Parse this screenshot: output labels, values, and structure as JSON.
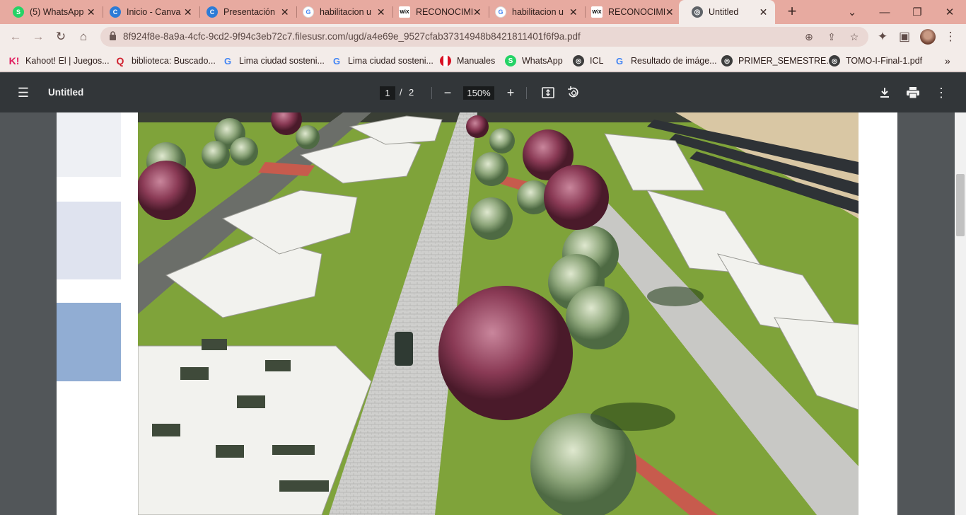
{
  "browser": {
    "tabs": [
      {
        "title": "(5) WhatsApp",
        "icon": "whatsapp-icon",
        "color": "#25d366",
        "glyph": "S"
      },
      {
        "title": "Inicio - Canva",
        "icon": "canva-icon",
        "color": "#2c7bd6",
        "glyph": "C"
      },
      {
        "title": "Presentación",
        "icon": "canva-icon",
        "color": "#2c7bd6",
        "glyph": "C"
      },
      {
        "title": "habilitacion u",
        "icon": "google-icon",
        "color": "#ffffff",
        "glyph": "G"
      },
      {
        "title": "RECONOCIMI",
        "icon": "wix-icon",
        "color": "#ffffff",
        "glyph": "WiX"
      },
      {
        "title": "habilitacion u",
        "icon": "google-icon",
        "color": "#ffffff",
        "glyph": "G"
      },
      {
        "title": "RECONOCIMI",
        "icon": "wix-icon",
        "color": "#ffffff",
        "glyph": "WiX"
      },
      {
        "title": "Untitled",
        "icon": "globe-icon",
        "color": "#5f6368",
        "glyph": "◎",
        "active": true
      }
    ],
    "url": "8f924f8e-8a9a-4cfc-9cd2-9f94c3eb72c7.filesusr.com/ugd/a4e69e_9527cfab37314948b8421811401f6f9a.pdf",
    "bookmarks": [
      {
        "label": "Kahoot! El | Juegos...",
        "icon": "kahoot-icon"
      },
      {
        "label": "biblioteca: Buscado...",
        "icon": "library-icon"
      },
      {
        "label": "Lima ciudad sosteni...",
        "icon": "google-icon"
      },
      {
        "label": "Lima ciudad sosteni...",
        "icon": "google-icon"
      },
      {
        "label": "Manuales",
        "icon": "peru-flag-icon"
      },
      {
        "label": "WhatsApp",
        "icon": "whatsapp-icon"
      },
      {
        "label": "ICL",
        "icon": "globe-icon"
      },
      {
        "label": "Resultado de imáge...",
        "icon": "google-icon"
      },
      {
        "label": "PRIMER_SEMESTRE...",
        "icon": "globe-icon"
      },
      {
        "label": "TOMO-I-Final-1.pdf",
        "icon": "globe-icon"
      }
    ]
  },
  "pdf": {
    "title": "Untitled",
    "current_page": "1",
    "separator": "/",
    "total_pages": "2",
    "zoom": "150%"
  },
  "colors": {
    "tabbar": "#e7aaa0",
    "toolbar": "#323639",
    "viewer_bg": "#525659"
  }
}
